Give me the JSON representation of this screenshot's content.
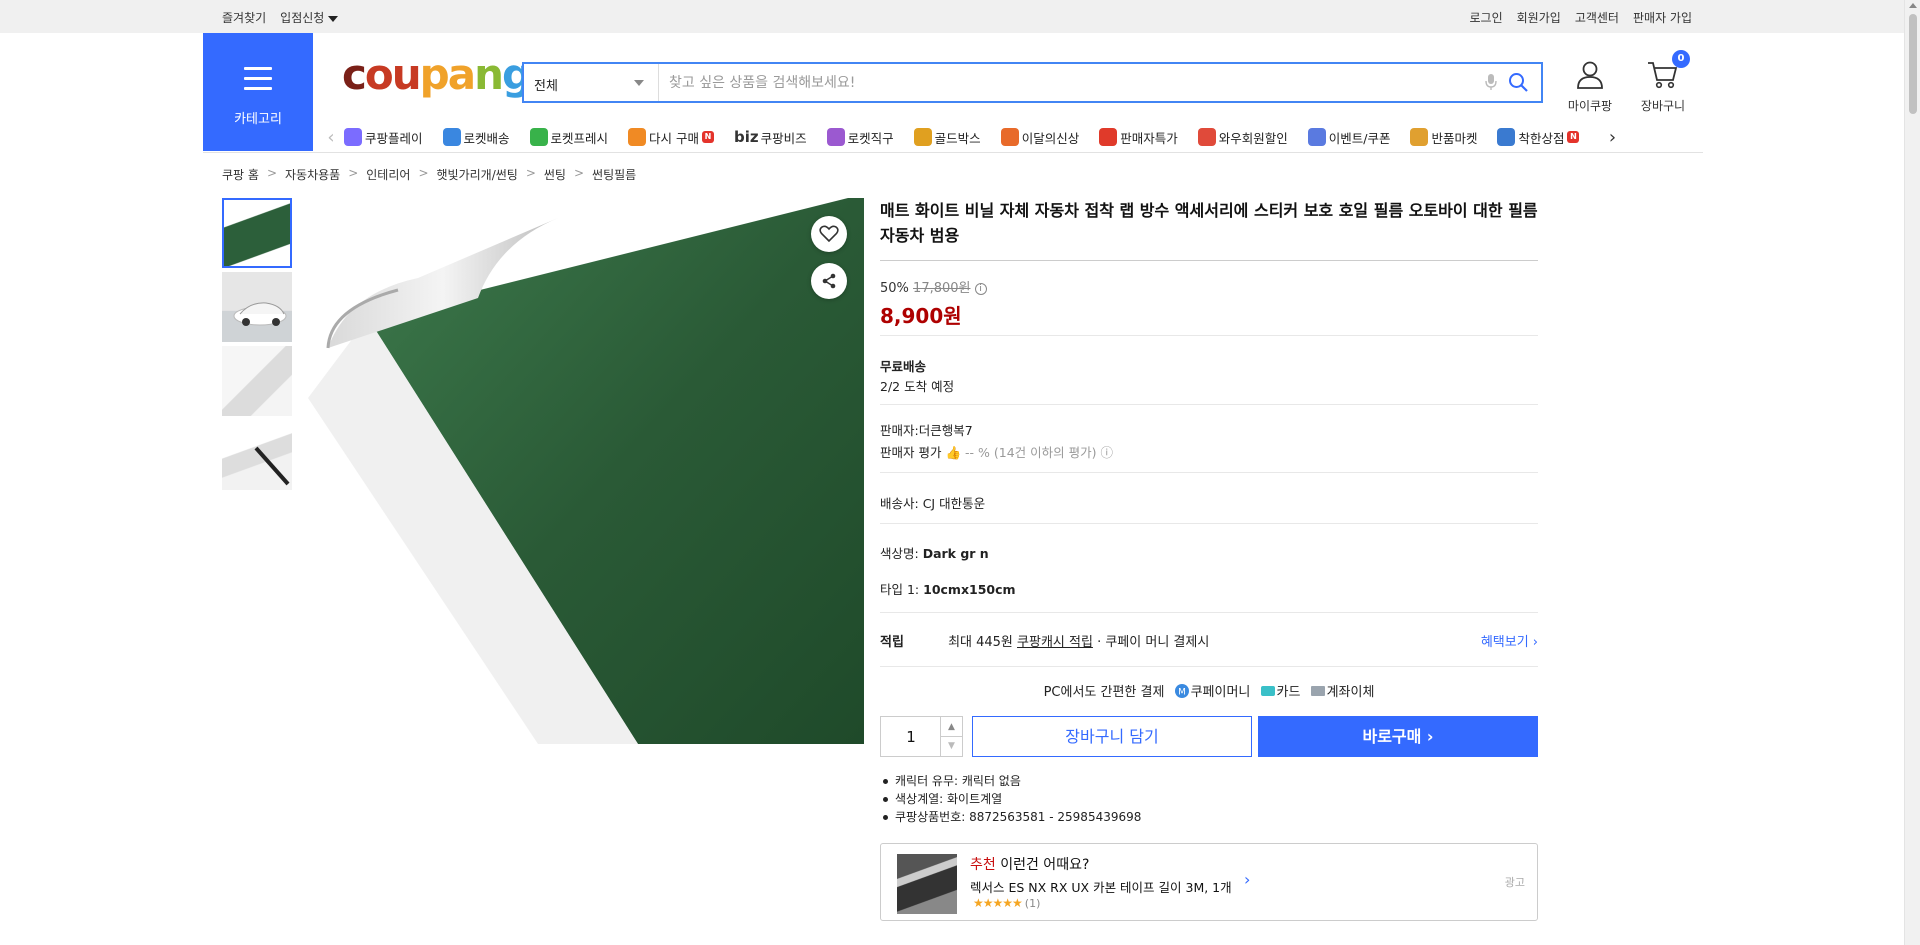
{
  "topbar": {
    "favorites": "즐겨찾기",
    "entry": "입점신청",
    "login": "로그인",
    "signup": "회원가입",
    "support": "고객센터",
    "seller_signup": "판매자 가입"
  },
  "header": {
    "category_label": "카테고리",
    "logo_parts": [
      "c",
      "ou",
      "pa",
      "n",
      "g"
    ],
    "search_category": "전체",
    "search_placeholder": "찾고 싶은 상품을 검색해보세요!",
    "my_coupang": "마이쿠팡",
    "cart_label": "장바구니",
    "cart_count": "0",
    "accent_color": "#346aff"
  },
  "nav": [
    {
      "label": "쿠팡플레이",
      "icon": "play-icon",
      "color": "#7b6cff"
    },
    {
      "label": "로켓배송",
      "icon": "rocket-icon",
      "color": "#3a87e0"
    },
    {
      "label": "로켓프레시",
      "icon": "rocket-fresh-icon",
      "color": "#38b24a"
    },
    {
      "label": "다시 구매",
      "icon": "rebuy-icon",
      "color": "#f08a24",
      "badge": "N"
    },
    {
      "label": "쿠팡비즈",
      "prefix": "biz",
      "icon": "biz-icon"
    },
    {
      "label": "로켓직구",
      "icon": "global-icon",
      "color": "#9b59d0"
    },
    {
      "label": "골드박스",
      "icon": "goldbox-icon",
      "color": "#e0a020"
    },
    {
      "label": "이달의신상",
      "icon": "new-icon",
      "color": "#e86a2a"
    },
    {
      "label": "판매자특가",
      "icon": "percent-icon",
      "color": "#e03a2a"
    },
    {
      "label": "와우회원할인",
      "icon": "wow-icon",
      "color": "#e04a3a"
    },
    {
      "label": "이벤트/쿠폰",
      "icon": "coupon-icon",
      "color": "#5a7ae0"
    },
    {
      "label": "반품마켓",
      "icon": "return-market-icon",
      "color": "#e0a030"
    },
    {
      "label": "착한상점",
      "icon": "good-store-icon",
      "color": "#3a7ad0",
      "badge": "N"
    }
  ],
  "breadcrumb": [
    "쿠팡 홈",
    "자동차용품",
    "인테리어",
    "햇빛가리개/썬팅",
    "썬팅",
    "썬팅필름"
  ],
  "product": {
    "title": "매트 화이트 비닐 자체 자동차 접착 랩 방수 액세서리에 스티커 보호 호일 필름 오토바이 대한 필름 자동차 범용",
    "discount": "50%",
    "original_price": "17,800원",
    "sale_price": "8,900원",
    "shipping_title": "무료배송",
    "arrival": "2/2 도착 예정",
    "seller": "판매자:더큰행복7",
    "seller_rating_label": "판매자 평가",
    "seller_rating_value": "-- % (14건 이하의 평가)",
    "courier_label": "배송사:",
    "courier": "CJ 대한통운",
    "color_label": "색상명:",
    "color_value": "Dark gr n",
    "type_label": "타입 1:",
    "type_value": "10cmx150cm",
    "reward_label": "적립",
    "reward_text_1": "최대 445원",
    "reward_text_2": "쿠팡캐시 적립",
    "reward_text_3": "· 쿠페이 머니 결제시",
    "benefit_link": "혜택보기",
    "pay_intro": "PC에서도 간편한 결제",
    "pay_methods": [
      "쿠페이머니",
      "카드",
      "계좌이체"
    ],
    "quantity": "1",
    "add_to_cart": "장바구니 담기",
    "buy_now": "바로구매",
    "bullets": [
      "캐릭터 유무: 캐릭터 없음",
      "색상계열: 화이트계열",
      "쿠팡상품번호: 8872563581 - 25985439698"
    ],
    "image_color": "#2a5a36"
  },
  "recommend": {
    "tag": "추천",
    "title": "이런건 어때요?",
    "item": "렉서스 ES NX RX UX 카본 테이프 길이 3M, 1개",
    "stars": "★★★★★",
    "count": "(1)",
    "ad": "광고"
  }
}
